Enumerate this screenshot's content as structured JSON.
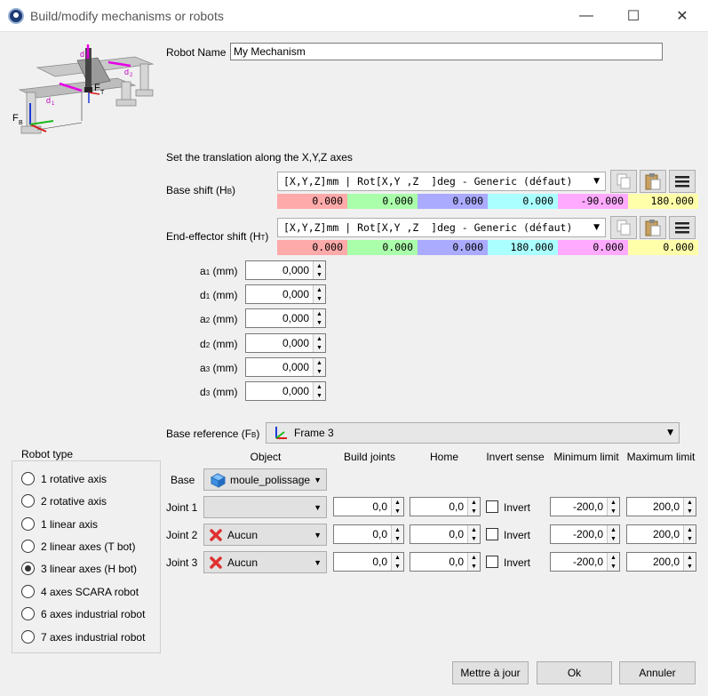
{
  "window": {
    "title": "Build/modify mechanisms or robots",
    "minimize": "—",
    "maximize": "☐",
    "close": "✕"
  },
  "robot_name": {
    "label": "Robot Name",
    "value": "My Mechanism"
  },
  "translation_title": "Set the translation along the X,Y,Z axes",
  "base_shift": {
    "label_main": "Base shift (H",
    "label_sub": "B",
    "label_end": ")",
    "format": "[X,Y,Z]mm | Rot[X,Y ,Z  ]deg - Generic (défaut)",
    "values": [
      "0.000",
      "0.000",
      "0.000",
      "0.000",
      "-90.000",
      "180.000"
    ]
  },
  "end_effector_shift": {
    "label_main": "End-effector shift (H",
    "label_sub": "T",
    "label_end": ")",
    "format": "[X,Y,Z]mm | Rot[X,Y ,Z  ]deg - Generic (défaut)",
    "values": [
      "0.000",
      "0.000",
      "0.000",
      "180.000",
      "0.000",
      "0.000"
    ]
  },
  "value_colors": [
    "#ffaaaa",
    "#aaffaa",
    "#aaaaff",
    "#aaffff",
    "#ffaaff",
    "#ffffaa"
  ],
  "params": [
    {
      "main": "a",
      "sub": "1",
      "unit": " (mm)",
      "value": "0,000"
    },
    {
      "main": "d",
      "sub": "1",
      "unit": " (mm)",
      "value": "0,000"
    },
    {
      "main": "a",
      "sub": "2",
      "unit": " (mm)",
      "value": "0,000"
    },
    {
      "main": "d",
      "sub": "2",
      "unit": " (mm)",
      "value": "0,000"
    },
    {
      "main": "a",
      "sub": "3",
      "unit": " (mm)",
      "value": "0,000"
    },
    {
      "main": "d",
      "sub": "3",
      "unit": " (mm)",
      "value": "0,000"
    }
  ],
  "base_reference": {
    "label_main": "Base reference (F",
    "label_sub": "B",
    "label_end": ")",
    "value": "Frame 3"
  },
  "joint_table": {
    "headers": [
      "Object",
      "Build joints",
      "Home",
      "Invert sense",
      "Minimum limit",
      "Maximum limit"
    ],
    "base": {
      "label": "Base",
      "object": "moule_polissage"
    },
    "joints": [
      {
        "label": "Joint 1",
        "object": "",
        "build": "0,0",
        "home": "0,0",
        "invert": "Invert",
        "min": "-200,0",
        "max": "200,0"
      },
      {
        "label": "Joint 2",
        "object": "Aucun",
        "build": "0,0",
        "home": "0,0",
        "invert": "Invert",
        "min": "-200,0",
        "max": "200,0"
      },
      {
        "label": "Joint 3",
        "object": "Aucun",
        "build": "0,0",
        "home": "0,0",
        "invert": "Invert",
        "min": "-200,0",
        "max": "200,0"
      }
    ]
  },
  "robot_type": {
    "title": "Robot type",
    "selected_index": 4,
    "options": [
      "1 rotative axis",
      "2 rotative axis",
      "1 linear axis",
      "2 linear axes (T bot)",
      "3 linear axes (H bot)",
      "4 axes SCARA robot",
      "6 axes industrial robot",
      "7 axes industrial robot"
    ]
  },
  "diagram_labels": {
    "d1": "d",
    "d2": "d",
    "d3": "d",
    "ft": "F",
    "fb": "F",
    "t": "T",
    "b": "B",
    "s1": "1",
    "s2": "2",
    "s3": "3"
  },
  "buttons": {
    "update": "Mettre à jour",
    "ok": "Ok",
    "cancel": "Annuler"
  }
}
